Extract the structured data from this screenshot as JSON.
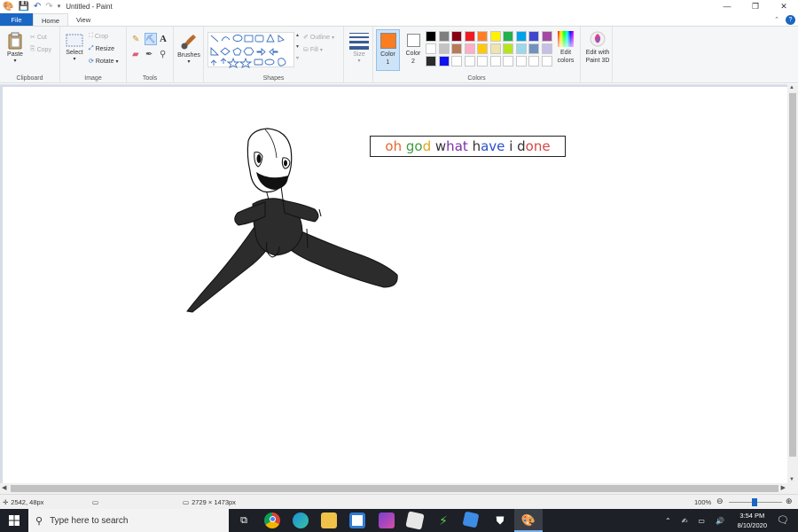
{
  "window": {
    "title": "Untitled - Paint",
    "controls": {
      "minimize": "—",
      "restore": "❐",
      "close": "✕"
    }
  },
  "tabs": {
    "file": "File",
    "home": "Home",
    "view": "View"
  },
  "ribbon": {
    "clipboard": {
      "label": "Clipboard",
      "paste": "Paste",
      "cut": "Cut",
      "copy": "Copy"
    },
    "image": {
      "label": "Image",
      "select": "Select",
      "crop": "Crop",
      "resize": "Resize",
      "rotate": "Rotate"
    },
    "tools": {
      "label": "Tools"
    },
    "brushes": {
      "label": "Brushes"
    },
    "shapes": {
      "label": "Shapes",
      "outline": "Outline",
      "fill": "Fill"
    },
    "size": {
      "label": "Size"
    },
    "colors": {
      "label": "Colors",
      "color1": "Color 1",
      "color2": "Color 2",
      "edit_colors": "Edit colors",
      "edit_paint3d": "Edit with Paint 3D",
      "color1_value": "#fa7d21",
      "color2_value": "#ffffff",
      "palette_row1": [
        "#000000",
        "#7f7f7f",
        "#880015",
        "#ed1c24",
        "#ff7f27",
        "#fff200",
        "#22b14c",
        "#00a2e8",
        "#3f48cc",
        "#a349a4"
      ],
      "palette_row2": [
        "#ffffff",
        "#c3c3c3",
        "#b97a57",
        "#ffaec9",
        "#ffc90e",
        "#efe4b0",
        "#b5e61d",
        "#99d9ea",
        "#7092be",
        "#c8bfe7"
      ],
      "palette_row3": [
        "#2b2b2b",
        "#1111ee",
        "#ffffff",
        "#ffffff",
        "#ffffff",
        "#ffffff",
        "#ffffff",
        "#ffffff",
        "#ffffff",
        "#ffffff"
      ]
    }
  },
  "canvas": {
    "text_box": "oh god what have i done",
    "text_letter_colors": [
      "#e8662b",
      "#e8662b",
      "",
      "#3f9b3f",
      "#3f9b3f",
      "#e3a417",
      "#e3a417",
      "",
      "#7b2db0",
      "#7b2db0",
      "#7b2db0",
      "#7b2db0",
      "",
      "#2a4fcf",
      "#2a4fcf",
      "#2a4fcf",
      "#2a4fcf",
      "",
      "#c9318a",
      "",
      "#d64545",
      "#d64545",
      "#d64545",
      "#d64545"
    ]
  },
  "status": {
    "cursor_pos": "2542, 48px",
    "canvas_size": "2729 × 1473px",
    "zoom": "100%"
  },
  "taskbar": {
    "search_placeholder": "Type here to search",
    "time": "3:54 PM",
    "date": "8/10/2020"
  }
}
